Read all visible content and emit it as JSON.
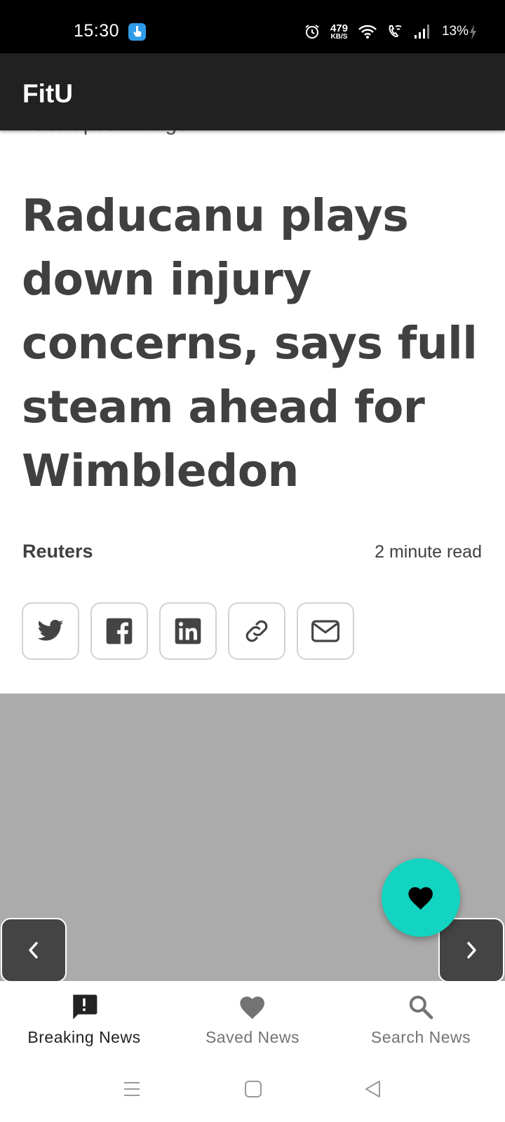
{
  "status_bar": {
    "time": "15:30",
    "speed_value": "479",
    "speed_unit": "KB/S",
    "battery": "13%",
    "icons": [
      "touch-app-icon",
      "alarm-icon",
      "wifi-icon",
      "wifi-calling-icon",
      "signal-icon",
      "charging-bolt-icon"
    ]
  },
  "app_bar": {
    "title": "FitU"
  },
  "article": {
    "updated_peek": "Last Updated ago",
    "headline": "Raducanu plays down injury concerns, says full steam ahead for Wimbledon",
    "source": "Reuters",
    "read_time": "2 minute read",
    "share_buttons": [
      "twitter-icon",
      "facebook-icon",
      "linkedin-icon",
      "link-icon",
      "email-icon"
    ]
  },
  "carousel": {
    "prev_icon": "chevron-left-icon",
    "next_icon": "chevron-right-icon",
    "fab_icon": "heart-icon"
  },
  "bottom_nav": {
    "items": [
      {
        "label": "Breaking News",
        "icon": "alert-message-icon",
        "active": true
      },
      {
        "label": "Saved News",
        "icon": "heart-icon",
        "active": false
      },
      {
        "label": "Search News",
        "icon": "search-icon",
        "active": false
      }
    ]
  },
  "system_nav": {
    "icons": [
      "menu-icon",
      "home-icon",
      "back-icon"
    ]
  },
  "colors": {
    "status_bar": "#000000",
    "app_bar": "#212121",
    "headline": "#404040",
    "image_placeholder": "#ababab",
    "fab": "#12d4c0",
    "nav_arrow": "#444444"
  }
}
